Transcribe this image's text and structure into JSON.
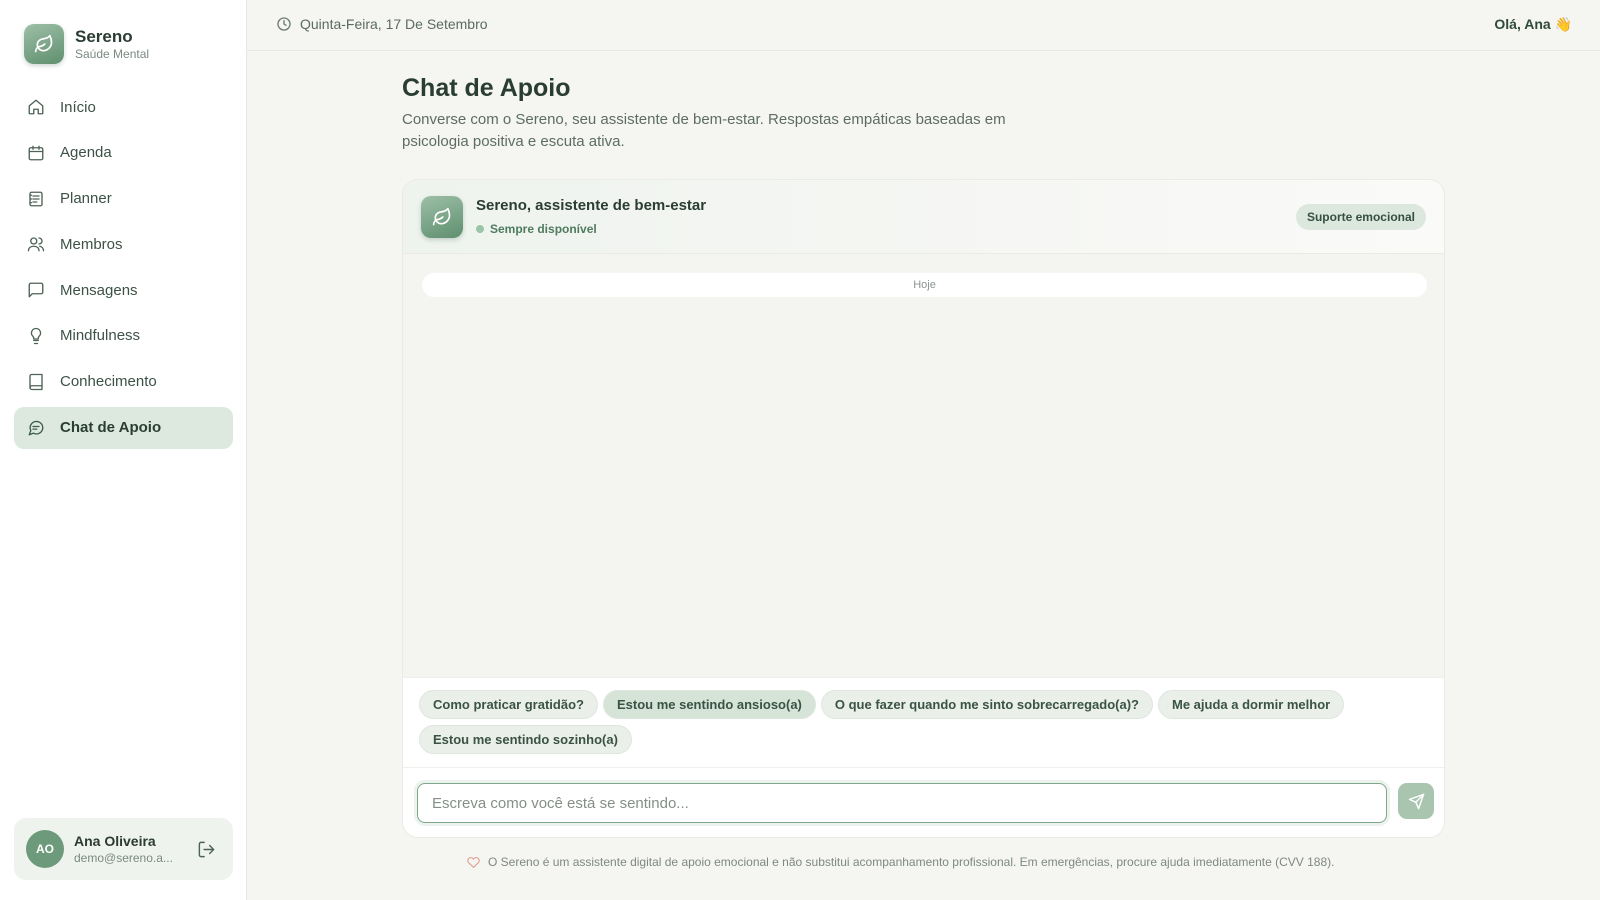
{
  "brand": {
    "name": "Sereno",
    "subtitle": "Saúde Mental"
  },
  "nav": {
    "items": [
      {
        "label": "Início",
        "icon": "home-icon"
      },
      {
        "label": "Agenda",
        "icon": "calendar-icon"
      },
      {
        "label": "Planner",
        "icon": "planner-icon"
      },
      {
        "label": "Membros",
        "icon": "users-icon"
      },
      {
        "label": "Mensagens",
        "icon": "message-icon"
      },
      {
        "label": "Mindfulness",
        "icon": "lightbulb-icon"
      },
      {
        "label": "Conhecimento",
        "icon": "book-icon"
      },
      {
        "label": "Chat de Apoio",
        "icon": "chat-icon",
        "active": true
      }
    ]
  },
  "user": {
    "initials": "AO",
    "name": "Ana Oliveira",
    "email": "demo@sereno.a..."
  },
  "topbar": {
    "date": "Quinta-Feira, 17 De Setembro",
    "greeting": "Olá, Ana 👋"
  },
  "page": {
    "title": "Chat de Apoio",
    "description": "Converse com o Sereno, seu assistente de bem-estar. Respostas empáticas baseadas em psicologia positiva e escuta ativa."
  },
  "chat": {
    "bot_name": "Sereno, assistente de bem-estar",
    "status": "Sempre disponível",
    "badge": "Suporte emocional",
    "day_separator": "Hoje",
    "suggestions": [
      "Como praticar gratidão?",
      "Estou me sentindo ansioso(a)",
      "O que fazer quando me sinto sobrecarregado(a)?",
      "Me ajuda a dormir melhor",
      "Estou me sentindo sozinho(a)"
    ],
    "input_placeholder": "Escreva como você está se sentindo...",
    "input_value": ""
  },
  "disclaimer": "O Sereno é um assistente digital de apoio emocional e não substitui acompanhamento profissional. Em emergências, procure ajuda imediatamente (CVV 188).",
  "colors": {
    "accent": "#6d9a7b",
    "active_nav_bg": "#dde9df",
    "background": "#f5f5f2"
  }
}
